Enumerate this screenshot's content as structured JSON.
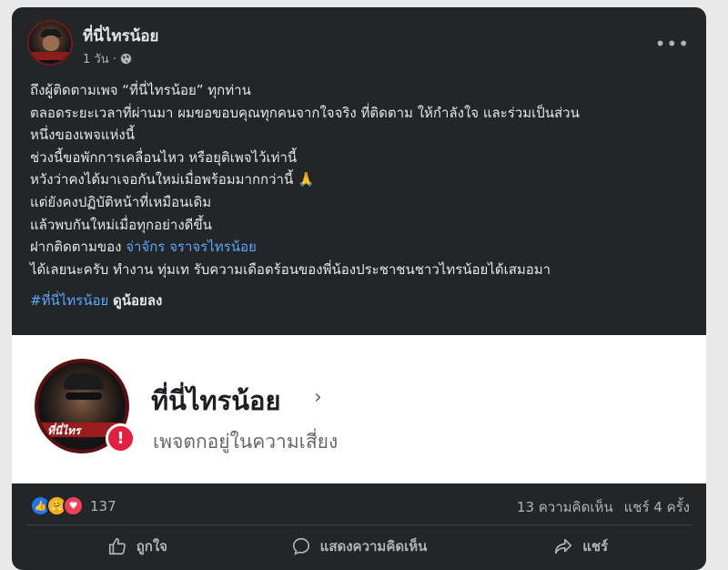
{
  "post": {
    "page_name": "ที่นี่ไทรน้อย",
    "time": "1 วัน ·",
    "lines": [
      "ถึงผู้ติดตามเพจ “ที่นี่ไทรน้อย” ทุกท่าน",
      "ตลอดระยะเวลาที่ผ่านมา ผมขอขอบคุณทุกคนจากใจจริง ที่ติดตาม ให้กำลังใจ และร่วมเป็นส่วน",
      "หนึ่งของเพจแห่งนี้",
      "ช่วงนี้ขอพักการเคลื่อนไหว หรือยุติเพจไว้เท่านี้",
      "หวังว่าคงได้มาเจอกันใหม่เมื่อพร้อมมากกว่านี้ 🙏",
      "แต่ยังคงปฏิบัติหน้าที่เหมือนเดิม",
      "แล้วพบกันใหม่เมื่อทุกอย่างดีขึ้น"
    ],
    "follow_prefix": "ฝากติดตามของ ",
    "follow_link": "จ่าจักร จราจรไทรน้อย",
    "closing_line": "ได้เลยนะครับ ทำงาน ทุ่มเท รับความเดือดร้อนของพี่น้องประชาชนชาวไทรน้อยได้เสมอมา",
    "hashtag": "#ที่นี่ไทรน้อย",
    "see_more": "ดูน้อยลง"
  },
  "shared_image": {
    "name": "ที่นี่ไทรน้อย",
    "chevron": "›",
    "status": "เพจตกอยู่ในความเสี่ยง",
    "badge": "!",
    "watermark": "ที่นี่ไทร"
  },
  "engagement": {
    "reaction_count": "137",
    "comments": "13 ความคิดเห็น",
    "shares": "แชร์ 4 ครั้ง"
  },
  "actions": {
    "like": "ถูกใจ",
    "comment": "แสดงความคิดเห็น",
    "share": "แชร์"
  },
  "icons": [
    "globe-icon",
    "more-icon",
    "like-reaction-icon",
    "care-reaction-icon",
    "love-reaction-icon",
    "like-icon",
    "comment-icon",
    "share-icon",
    "warning-icon"
  ]
}
